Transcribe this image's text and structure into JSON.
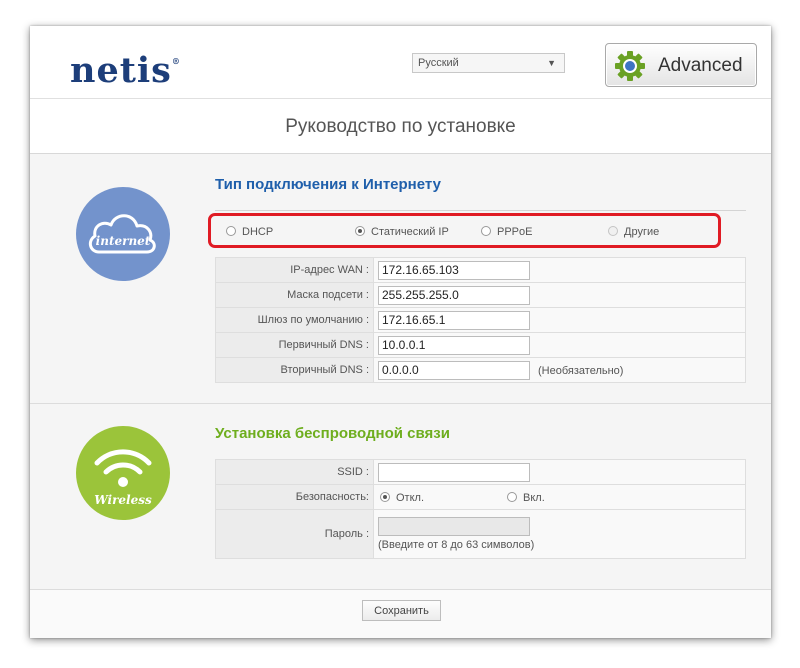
{
  "header": {
    "logo_text": "netis",
    "logo_tm": "®",
    "language": {
      "selected": "Русский"
    },
    "advanced_label": "Advanced"
  },
  "page_title": "Руководство по установке",
  "internet": {
    "icon_label": "internet",
    "title": "Тип подключения к Интернету",
    "connection_types": [
      {
        "label": "DHCP",
        "selected": false
      },
      {
        "label": "Статический IP",
        "selected": true
      },
      {
        "label": "PPPoE",
        "selected": false
      },
      {
        "label": "Другие",
        "selected": false
      }
    ],
    "fields": [
      {
        "label": "IP-адрес WAN :",
        "value": "172.16.65.103"
      },
      {
        "label": "Маска подсети :",
        "value": "255.255.255.0"
      },
      {
        "label": "Шлюз по умолчанию :",
        "value": "172.16.65.1"
      },
      {
        "label": "Первичный DNS :",
        "value": "10.0.0.1"
      },
      {
        "label": "Вторичный DNS :",
        "value": "0.0.0.0",
        "hint": "(Необязательно)"
      }
    ]
  },
  "wireless": {
    "icon_label": "Wireless",
    "title": "Установка беспроводной связи",
    "ssid_label": "SSID :",
    "ssid_value": "",
    "security_label": "Безопасность:",
    "security_off": "Откл.",
    "security_on": "Вкл.",
    "password_label": "Пароль :",
    "password_hint": "(Введите от 8 до 63 символов)"
  },
  "footer": {
    "save_label": "Сохранить"
  },
  "colors": {
    "brand": "#1d3e7a",
    "internet_title": "#1f5fab",
    "wireless_title": "#6eae1e",
    "internet_circle": "#7393cc",
    "wireless_circle": "#9bc43a",
    "highlight": "#e01b24"
  }
}
